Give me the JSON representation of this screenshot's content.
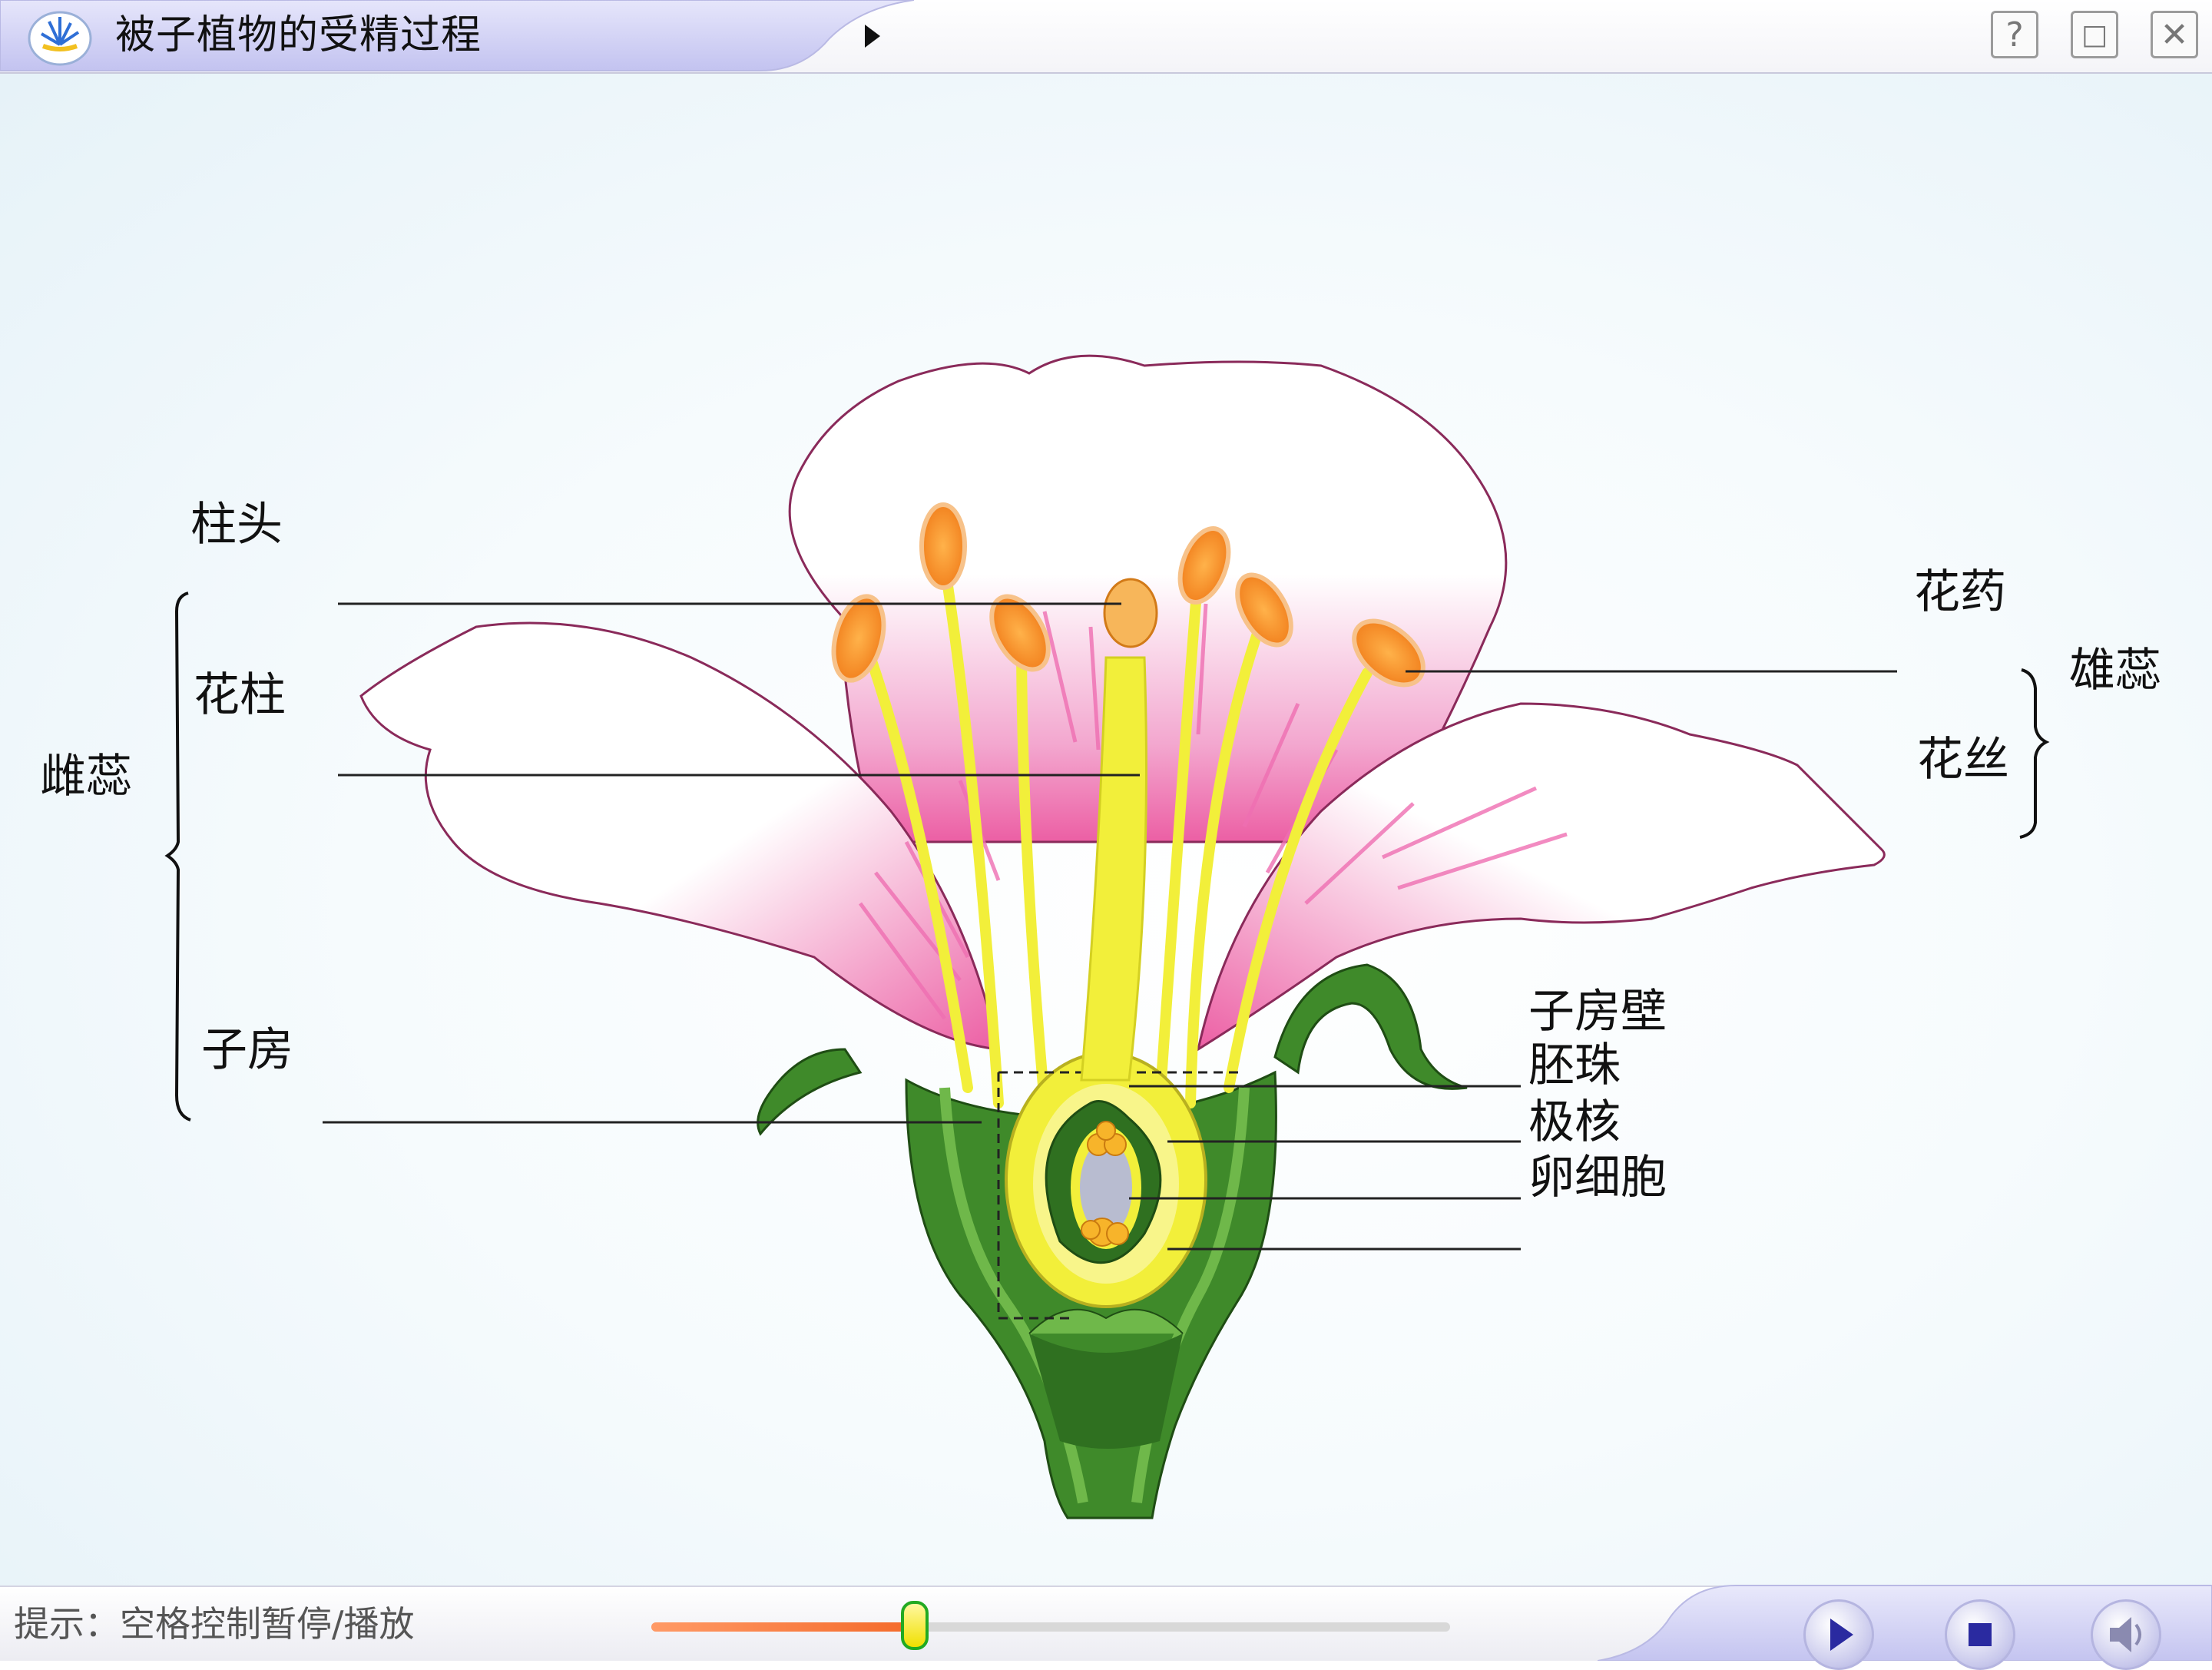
{
  "window": {
    "title": "被子植物的受精过程",
    "buttons": {
      "help": "?",
      "maximize": "□",
      "close": "✕"
    }
  },
  "diagram": {
    "left_labels": {
      "stigma": "柱头",
      "style": "花柱",
      "pistil": "雌蕊",
      "ovary": "子房"
    },
    "right_labels": {
      "anther": "花药",
      "filament": "花丝",
      "stamen": "雄蕊",
      "ovary_wall": "子房壁",
      "ovule": "胚珠",
      "polar_nuclei": "极核",
      "egg_cell": "卵细胞"
    }
  },
  "controls": {
    "hint": "提示：空格控制暂停/播放",
    "progress": 0.33,
    "icons": [
      "play-icon",
      "stop-icon",
      "speaker-icon"
    ]
  },
  "colors": {
    "title_tab": "#c9c9f3",
    "petal_pink": "#ec5fa4",
    "pistil_yellow": "#f2ef3a",
    "anther_orange": "#f7932a",
    "sepal_green": "#3f8a2a",
    "progress_fill": "#f46a2a"
  }
}
